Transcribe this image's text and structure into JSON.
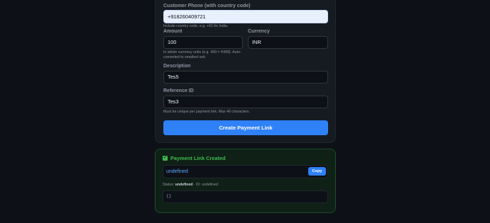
{
  "form": {
    "phone_label": "Customer Phone (with country code)",
    "phone_value": "+918260409721",
    "phone_help": "Include country code, e.g. +91 for India.",
    "amount_label": "Amount",
    "amount_value": "100",
    "amount_help": "In whole currency units (e.g. 499 = ₹499). Auto-converted to smallest unit.",
    "currency_label": "Currency",
    "currency_value": "INR",
    "description_label": "Description",
    "description_value": "Tes5",
    "reference_label": "Reference ID",
    "reference_value": "Tes3",
    "reference_help": "Must be unique per payment link. Max 40 characters.",
    "submit_label": "Create Payment Link"
  },
  "result": {
    "title": "Payment Link Created",
    "link_text": "undefined",
    "copy_label": "Copy",
    "status_prefix": "Status: ",
    "status_value": "undefined",
    "id_text": " · ID: undefined",
    "json_text": "{}"
  },
  "colors": {
    "accent": "#2f81f7",
    "success": "#3fb950",
    "background": "#0d1117",
    "card": "#161b22"
  }
}
